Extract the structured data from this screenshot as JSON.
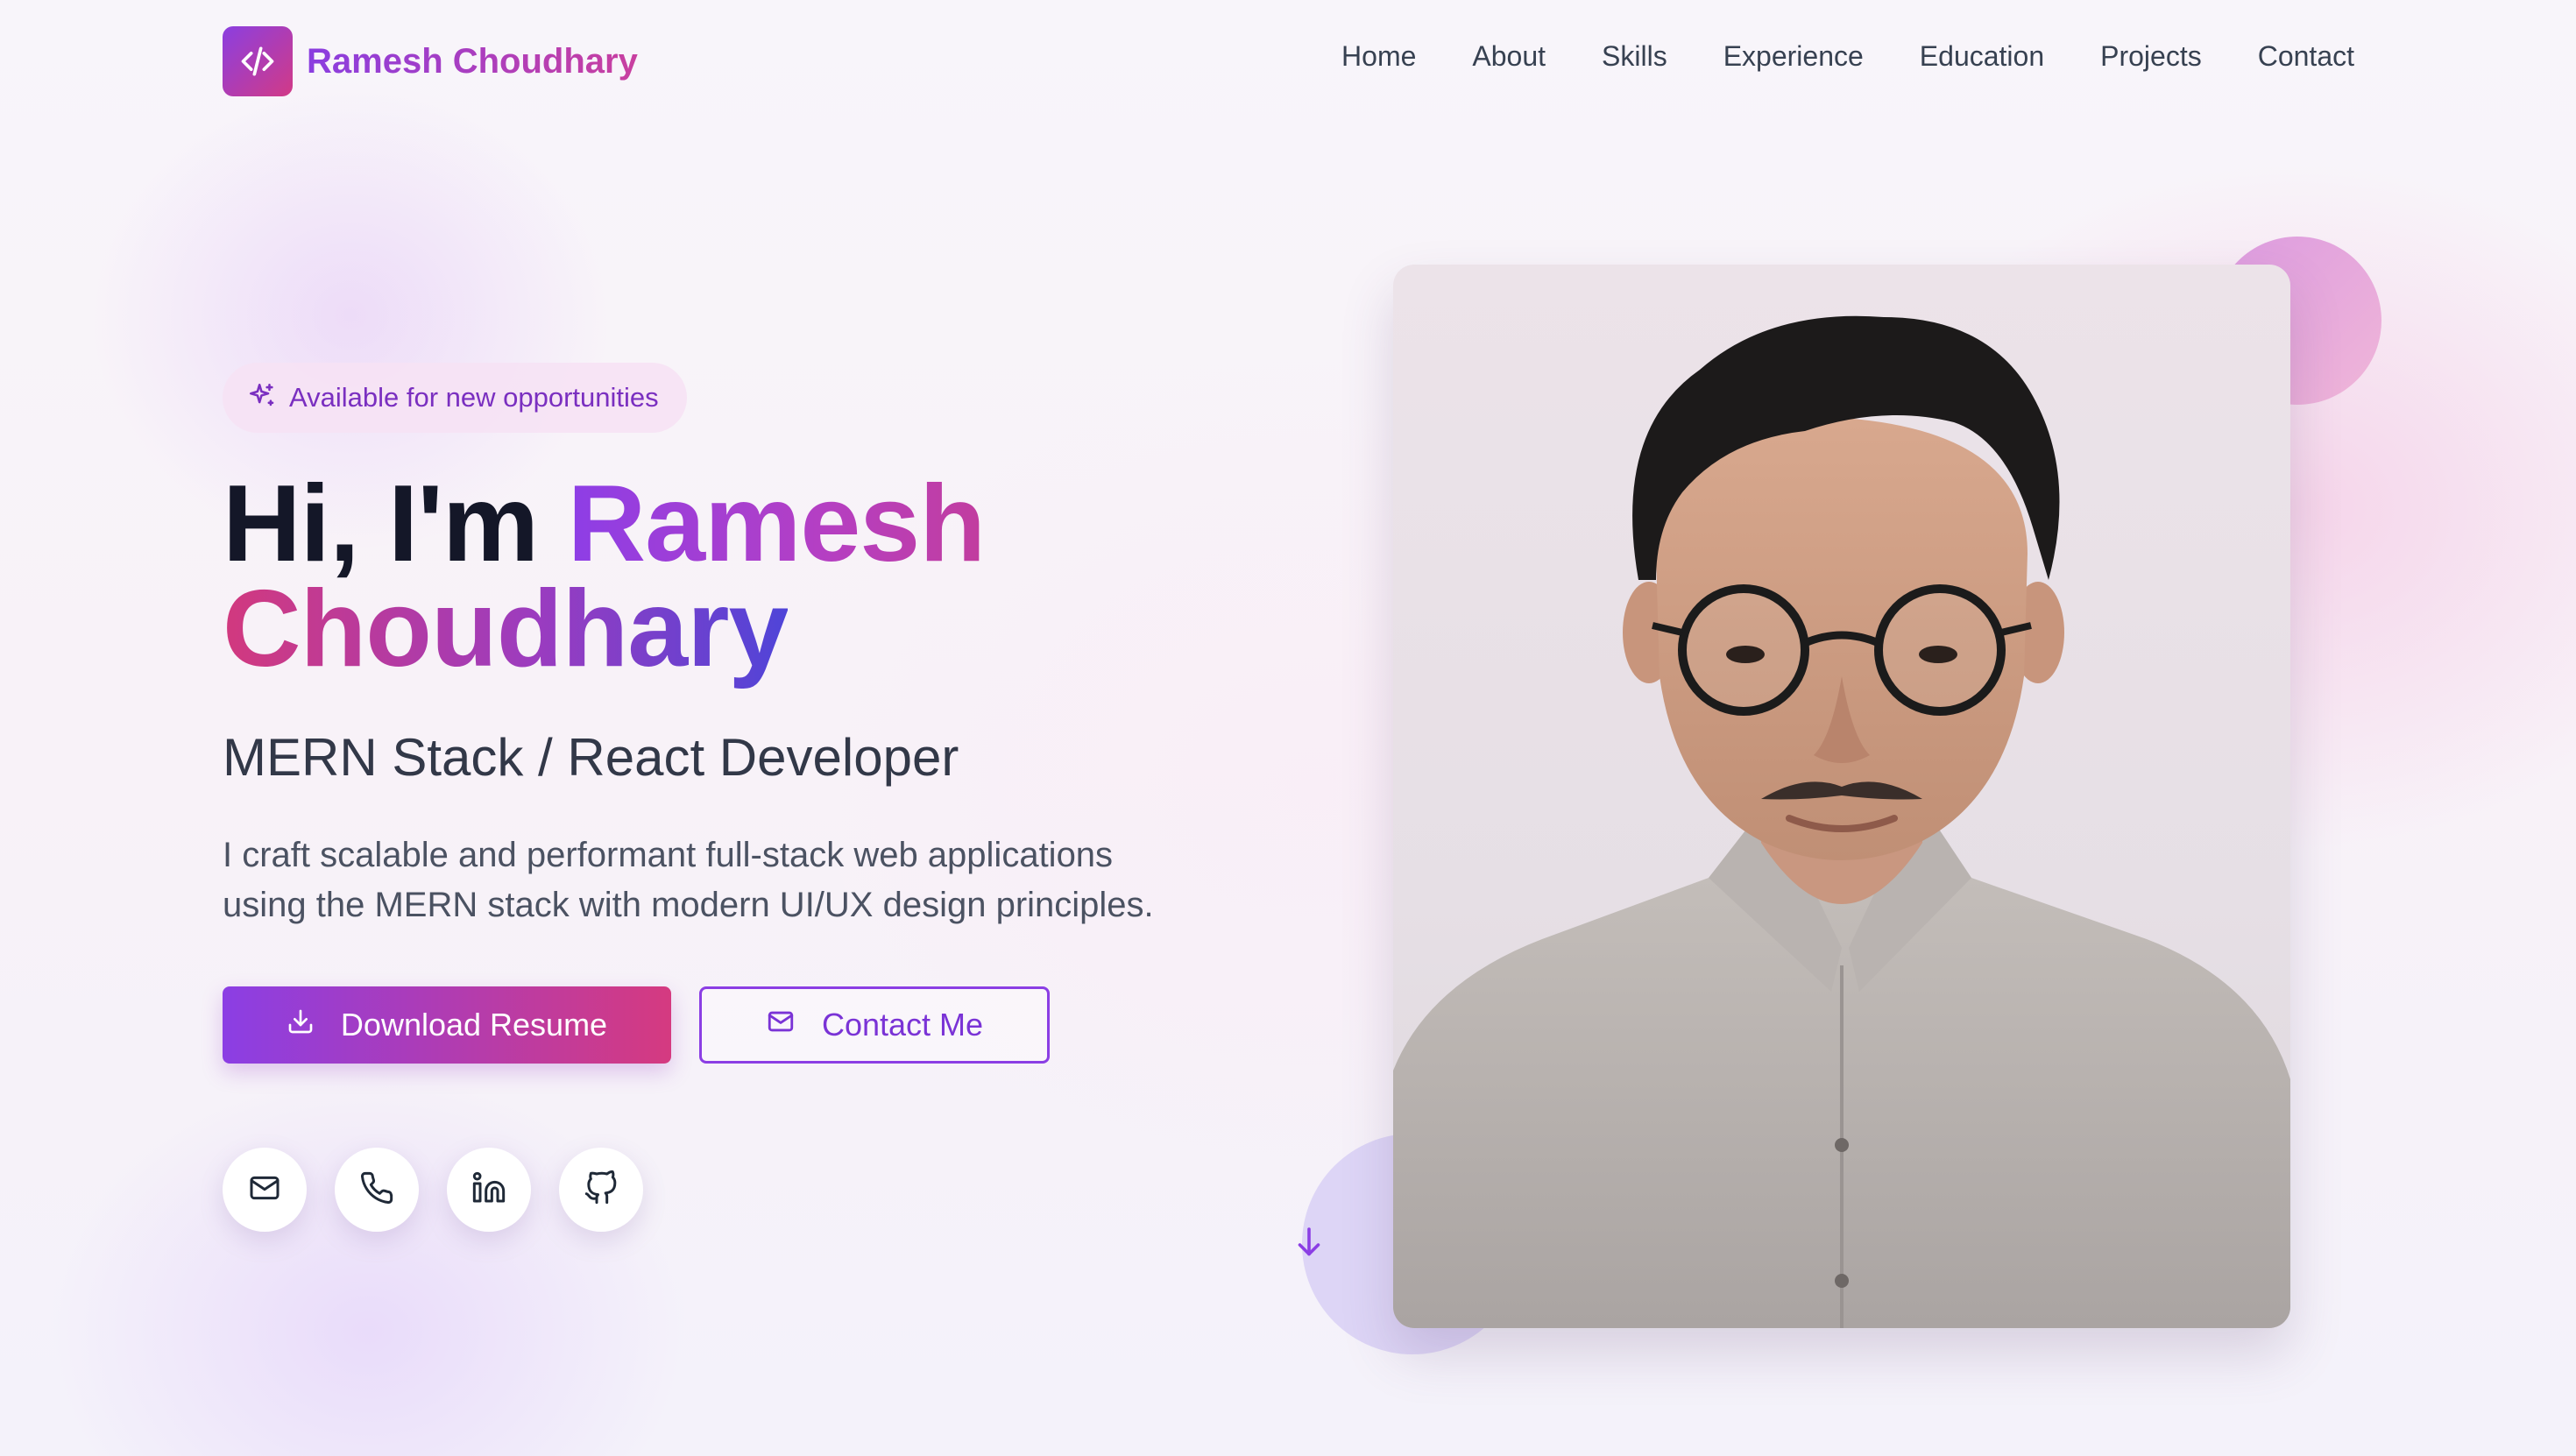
{
  "nav": {
    "brand": "Ramesh Choudhary",
    "brand_icon": "code-icon",
    "links": [
      "Home",
      "About",
      "Skills",
      "Experience",
      "Education",
      "Projects",
      "Contact"
    ]
  },
  "hero": {
    "badge": "Available for new opportunities",
    "badge_icon": "sparkles-icon",
    "greeting": "Hi, I'm",
    "name_first": "Ramesh",
    "name_last": "Choudhary",
    "role": "MERN Stack / React Developer",
    "description_line1": "I craft scalable and performant full-stack web applications",
    "description_line2": "using the MERN stack with modern UI/UX design principles.",
    "primary_button": "Download Resume",
    "primary_button_icon": "download-icon",
    "secondary_button": "Contact Me",
    "secondary_button_icon": "mail-icon",
    "socials": [
      "mail-icon",
      "phone-icon",
      "linkedin-icon",
      "github-icon"
    ],
    "scroll_icon": "arrow-down-icon"
  },
  "colors": {
    "accent_purple": "#8b3ee4",
    "accent_pink": "#d53a80",
    "text_dark": "#141728",
    "background": "#f7f3f9"
  }
}
